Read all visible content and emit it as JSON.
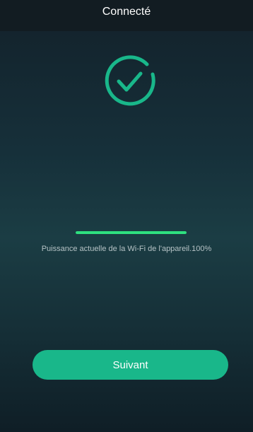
{
  "header": {
    "title": "Connecté"
  },
  "status_icon": "check-circle-icon",
  "signal": {
    "text": "Puissance actuelle de la Wi-Fi de l'appareil.100%",
    "progress_percent": 100
  },
  "next_button": {
    "label": "Suivant"
  },
  "colors": {
    "accent": "#19b78a",
    "progress": "#2ee07f",
    "header_bg": "#121c22"
  }
}
